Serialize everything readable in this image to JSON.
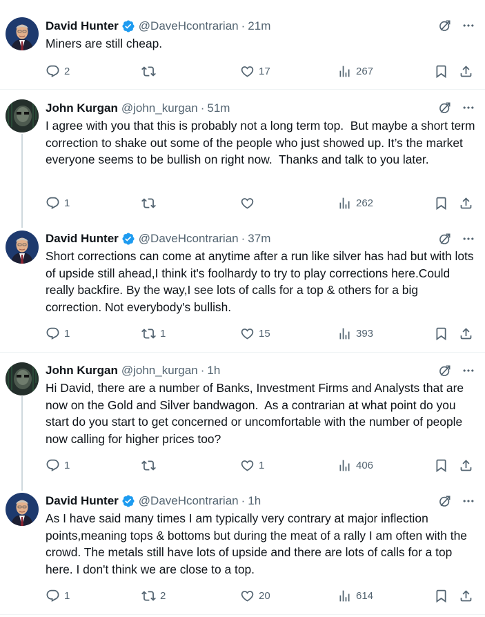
{
  "tweets": [
    {
      "name": "David Hunter",
      "verified": true,
      "handle": "@DaveHcontrarian",
      "time": "21m",
      "text": "Miners are still cheap.",
      "replies": "2",
      "reposts": "",
      "likes": "17",
      "views": "267",
      "avatar": "david"
    },
    {
      "name": "John Kurgan",
      "verified": false,
      "handle": "@john_kurgan",
      "time": "51m",
      "text": "I agree with you that this is probably not a long term top.  But maybe a short term correction to shake out some of the people who just showed up. It’s the market everyone seems to be bullish on right now.  Thanks and talk to you later.",
      "replies": "1",
      "reposts": "",
      "likes": "",
      "views": "262",
      "avatar": "john"
    },
    {
      "name": "David Hunter",
      "verified": true,
      "handle": "@DaveHcontrarian",
      "time": "37m",
      "text": "Short corrections can come at anytime after a run like silver has had but with lots of upside still ahead,I think it's foolhardy to try to play corrections here.Could really backfire. By the way,I see lots of calls for a top & others for a big correction. Not everybody's bullish.",
      "replies": "1",
      "reposts": "1",
      "likes": "15",
      "views": "393",
      "avatar": "david"
    },
    {
      "name": "John Kurgan",
      "verified": false,
      "handle": "@john_kurgan",
      "time": "1h",
      "text": "Hi David, there are a number of Banks, Investment Firms and Analysts that are now on the Gold and Silver bandwagon.  As a contrarian at what point do you start do you start to get concerned or uncomfortable with the number of people now calling for higher prices too?",
      "replies": "1",
      "reposts": "",
      "likes": "1",
      "views": "406",
      "avatar": "john"
    },
    {
      "name": "David Hunter",
      "verified": true,
      "handle": "@DaveHcontrarian",
      "time": "1h",
      "text": "As I have said many times I am typically very contrary at major inflection points,meaning tops & bottoms but during the meat of a rally I am often with the crowd. The metals still have lots of upside and there are lots of calls for a top here. I don't think we are close to a top.",
      "replies": "1",
      "reposts": "2",
      "likes": "20",
      "views": "614",
      "avatar": "david"
    }
  ],
  "separator": "·",
  "colors": {
    "verified": "#1d9bf0",
    "secondary_text": "#536471",
    "thread_line": "#cfd9de"
  },
  "icons": [
    "grok-icon",
    "more-icon",
    "reply-icon",
    "repost-icon",
    "like-icon",
    "views-icon",
    "bookmark-icon",
    "share-icon",
    "verified-badge-icon"
  ]
}
